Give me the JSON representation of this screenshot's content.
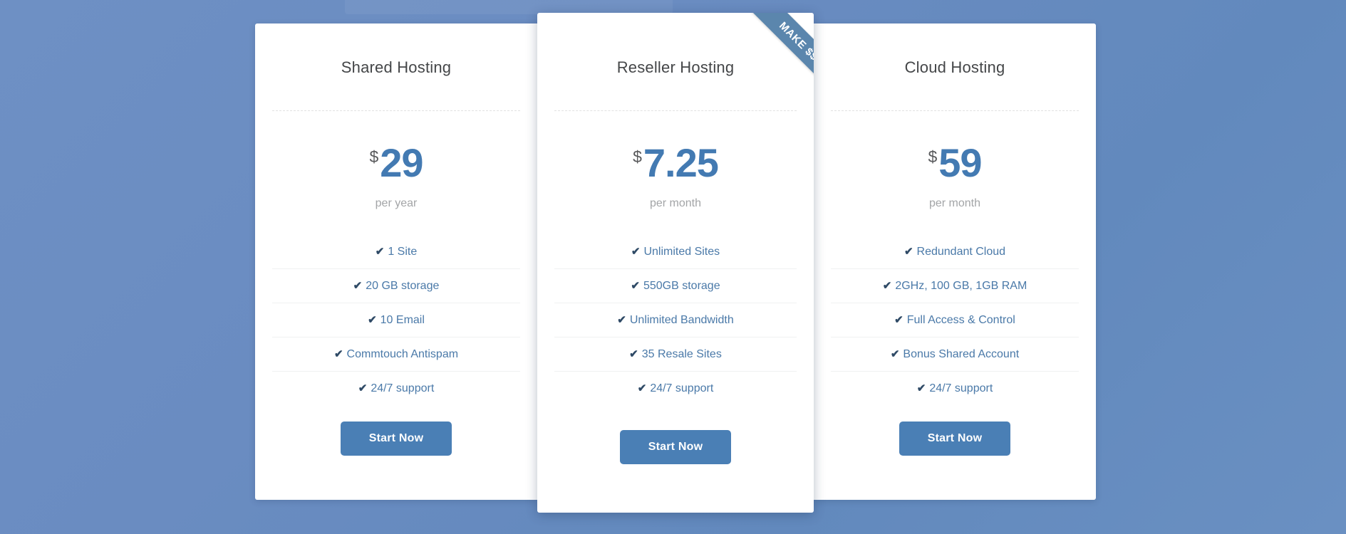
{
  "background": {
    "color_top_left": "#6e90c4",
    "color_bottom_right": "#6289bd"
  },
  "theme": {
    "accent": "#437ab2",
    "button": "#4a7fb5",
    "ribbon": "#5b86ad",
    "feature_text": "#4a79a8",
    "title_text": "#444648",
    "period_text": "#a3a5a7"
  },
  "ribbon": {
    "label": "MAKE $$$"
  },
  "icons": {
    "check": "check-icon",
    "check_glyph": "✔"
  },
  "plans": [
    {
      "id": "shared-hosting",
      "title": "Shared Hosting",
      "currency": "$",
      "amount": "29",
      "period": "per year",
      "featured": false,
      "features": [
        "1 Site",
        "20 GB storage",
        "10 Email",
        "Commtouch Antispam",
        "24/7 support"
      ],
      "cta": "Start Now"
    },
    {
      "id": "reseller-hosting",
      "title": "Reseller Hosting",
      "currency": "$",
      "amount": "7.25",
      "period": "per month",
      "featured": true,
      "features": [
        "Unlimited Sites",
        "550GB storage",
        "Unlimited Bandwidth",
        "35 Resale Sites",
        "24/7 support"
      ],
      "cta": "Start Now"
    },
    {
      "id": "cloud-hosting",
      "title": "Cloud Hosting",
      "currency": "$",
      "amount": "59",
      "period": "per month",
      "featured": false,
      "features": [
        "Redundant Cloud",
        "2GHz, 100 GB, 1GB RAM",
        "Full Access & Control",
        "Bonus Shared Account",
        "24/7 support"
      ],
      "cta": "Start Now"
    }
  ]
}
